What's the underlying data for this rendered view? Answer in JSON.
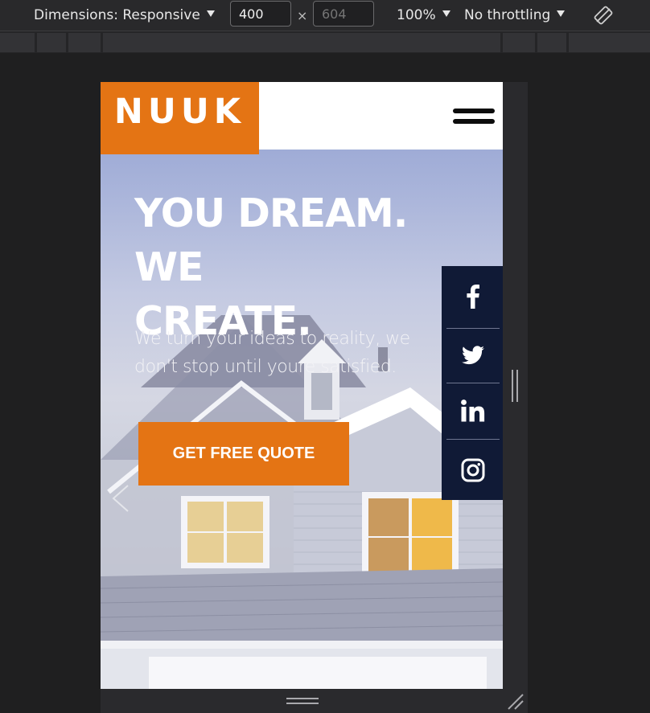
{
  "devtools": {
    "dimensions_label": "Dimensions: Responsive",
    "width_value": "400",
    "height_placeholder": "604",
    "times": "×",
    "zoom": "100%",
    "throttling": "No throttling"
  },
  "site": {
    "logo": "NUUK",
    "headline_line1": "YOU DREAM. WE",
    "headline_line2": "CREATE.",
    "subtext_line1": "We turn your ideas to reality, we",
    "subtext_line2": "don't stop until youre satisfied.",
    "cta_label": "GET FREE QUOTE",
    "social": [
      "facebook-icon",
      "twitter-icon",
      "linkedin-icon",
      "instagram-icon"
    ]
  },
  "colors": {
    "accent": "#e47414",
    "social_bar": "#101a36",
    "header_bg": "#ffffff"
  }
}
